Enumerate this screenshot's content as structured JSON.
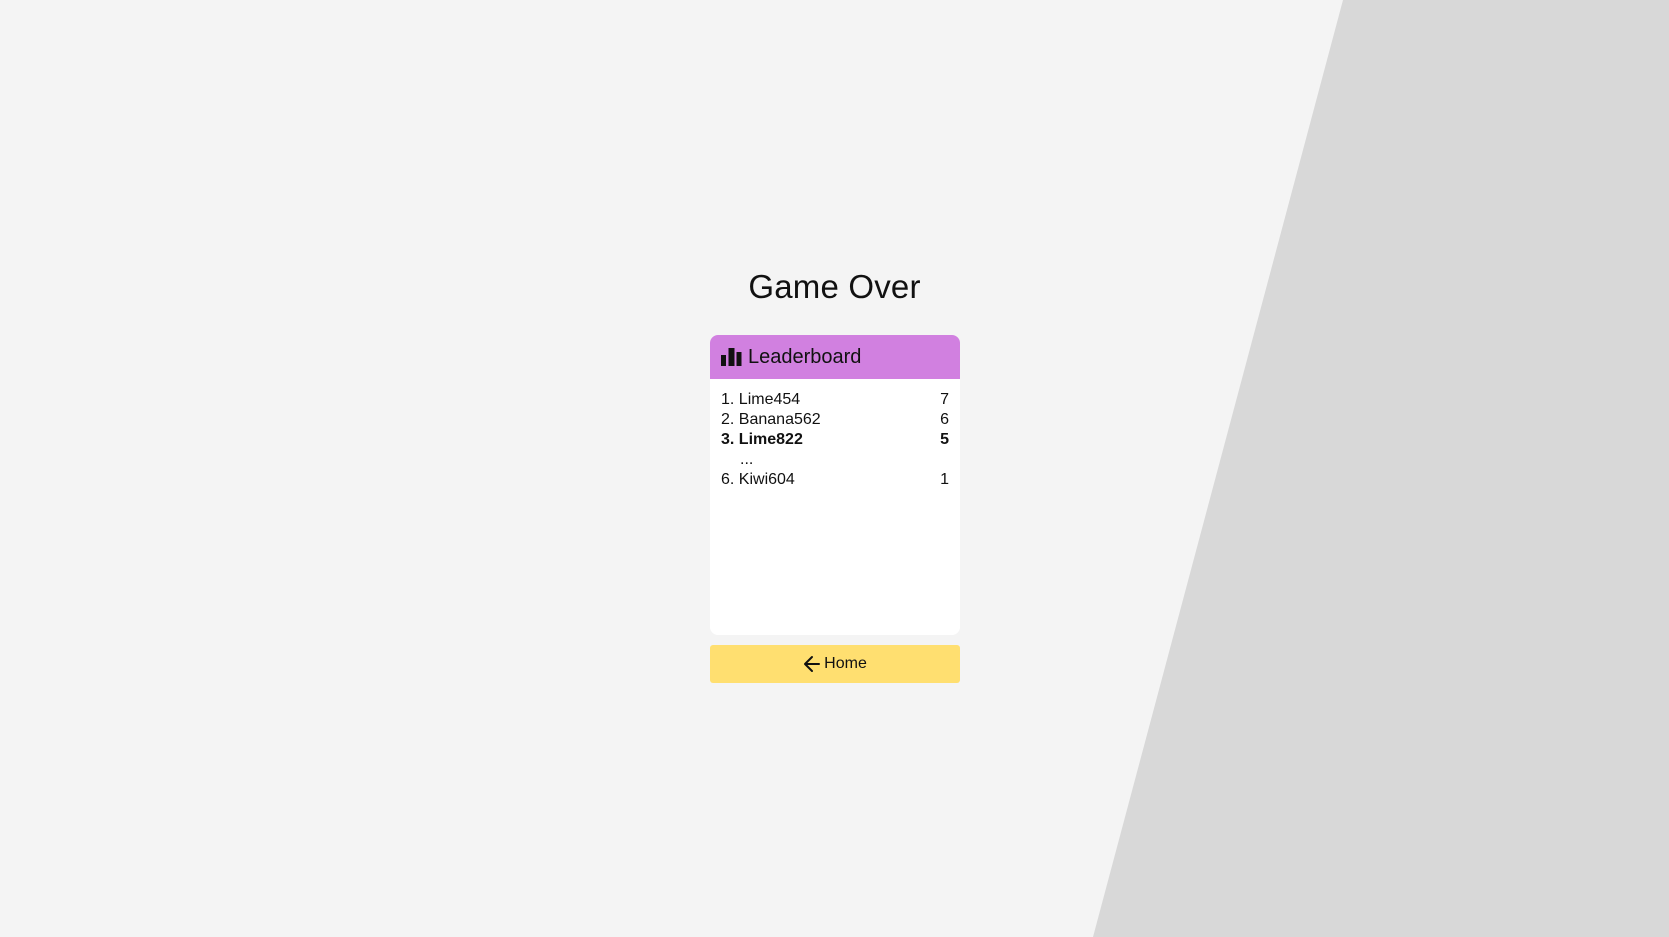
{
  "title": "Game Over",
  "leaderboard": {
    "header": "Leaderboard",
    "icon": "bar-chart-icon",
    "header_color": "#d180e0",
    "rows": [
      {
        "rank": "1.",
        "name": "Lime454",
        "score": "7",
        "highlight": false
      },
      {
        "rank": "2.",
        "name": "Banana562",
        "score": "6",
        "highlight": false
      },
      {
        "rank": "3.",
        "name": "Lime822",
        "score": "5",
        "highlight": true
      }
    ],
    "ellipsis": "...",
    "last_row": {
      "rank": "6.",
      "name": "Kiwi604",
      "score": "1",
      "highlight": false
    }
  },
  "home_button": {
    "label": "Home",
    "icon": "arrow-left-icon",
    "color": "#ffdf70"
  },
  "colors": {
    "background": "#f4f4f4",
    "wedge": "#d8d8d8"
  }
}
